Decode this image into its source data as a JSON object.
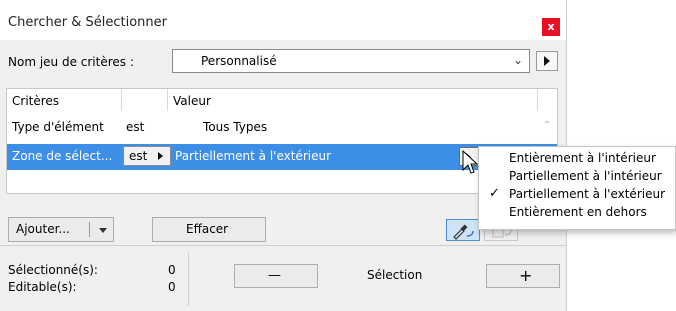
{
  "window": {
    "title": "Chercher & Sélectionner",
    "close_glyph": "x"
  },
  "criteria_set": {
    "label": "Nom jeu de critères :",
    "value": "Personnalisé"
  },
  "table": {
    "headers": {
      "criteria": "Critères",
      "value": "Valeur"
    },
    "rows": [
      {
        "criteria": "Type d'élément",
        "operator": "est",
        "value": "Tous Types"
      },
      {
        "criteria": "Zone de sélect...",
        "operator": "est",
        "value": "Partiellement à l'extérieur"
      }
    ]
  },
  "buttons": {
    "add": "Ajouter...",
    "clear": "Effacer",
    "minus": "—",
    "plus": "+"
  },
  "dropdown_menu": {
    "items": [
      {
        "label": "Entièrement à l'intérieur",
        "checked": false
      },
      {
        "label": "Partiellement à l'intérieur",
        "checked": false
      },
      {
        "label": "Partiellement à l'extérieur",
        "checked": true
      },
      {
        "label": "Entièrement en dehors",
        "checked": false
      }
    ],
    "check_glyph": "✓"
  },
  "stats": {
    "selected_label": "Sélectionné(s):",
    "selected_value": "0",
    "editable_label": "Editable(s):",
    "editable_value": "0"
  },
  "selection_label": "Sélection",
  "colors": {
    "selection": "#3d8ee6",
    "close": "#e81123",
    "accent_button": "#cde3f7"
  }
}
